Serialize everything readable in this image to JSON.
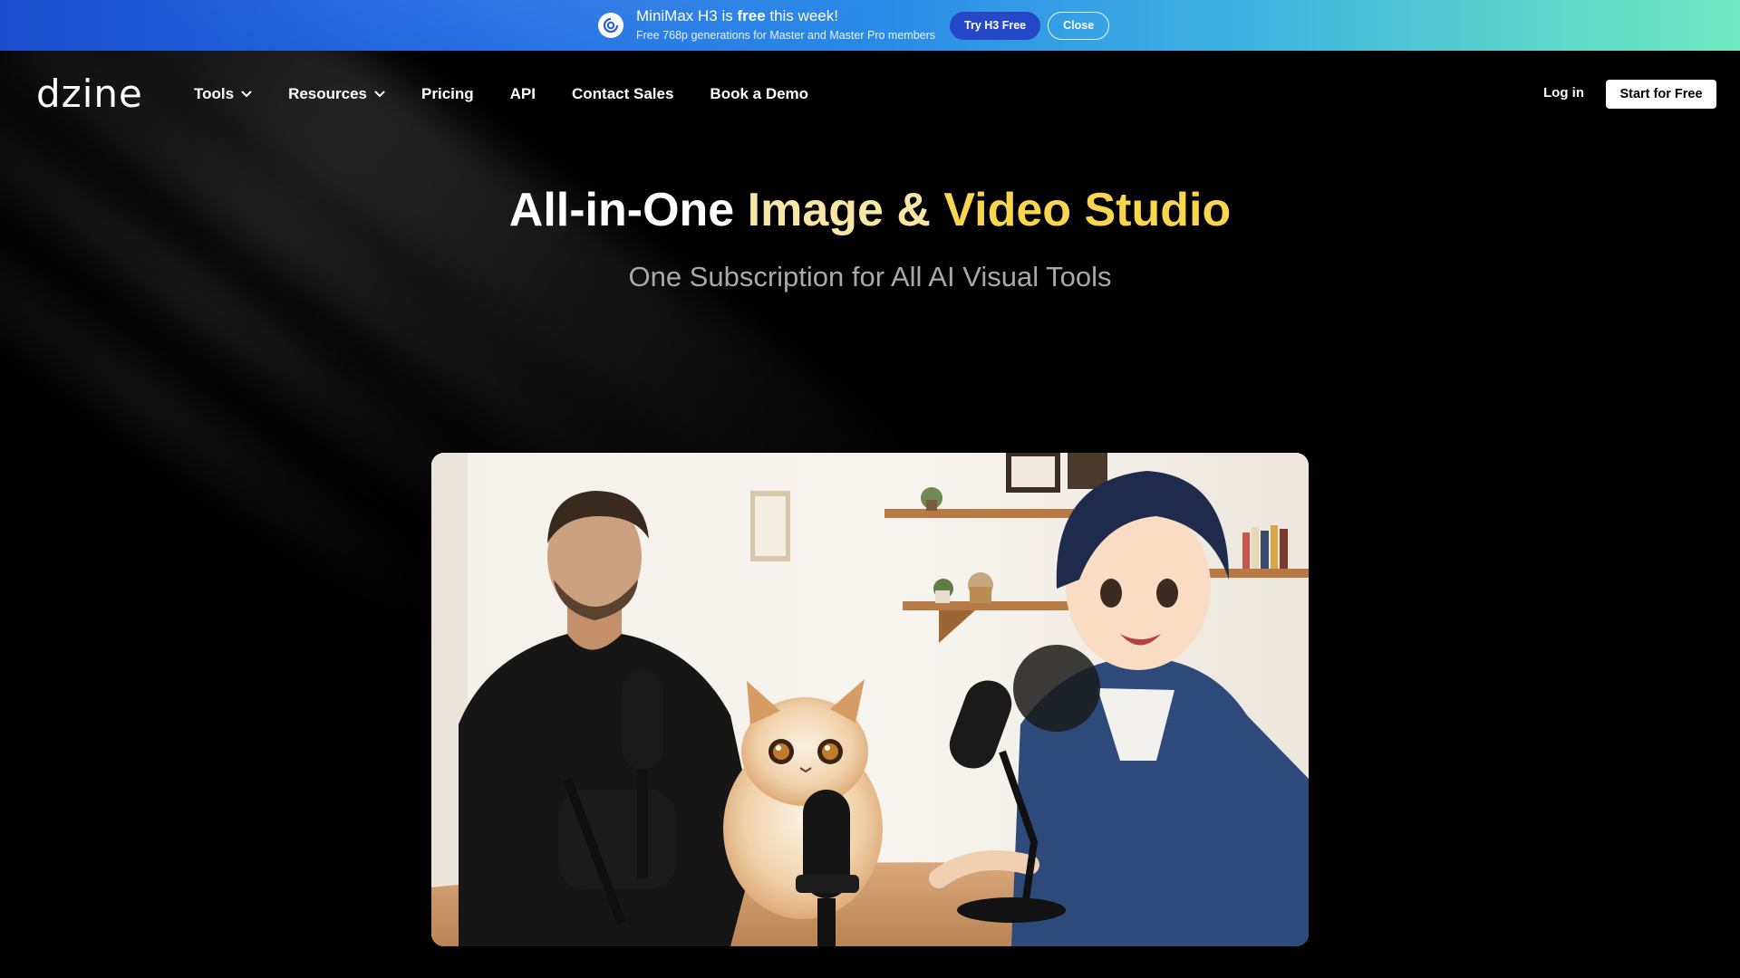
{
  "banner": {
    "headline_prefix": "MiniMax H3 is ",
    "headline_bold": "free",
    "headline_suffix": " this week!",
    "subtext": "Free 768p generations for Master and Master Pro members",
    "try_button": "Try H3 Free",
    "close_button": "Close",
    "icon": "minimax-logo-icon"
  },
  "nav": {
    "logo": "dzine",
    "items": [
      {
        "label": "Tools",
        "has_dropdown": true
      },
      {
        "label": "Resources",
        "has_dropdown": true
      },
      {
        "label": "Pricing",
        "has_dropdown": false
      },
      {
        "label": "API",
        "has_dropdown": false
      },
      {
        "label": "Contact Sales",
        "has_dropdown": false
      },
      {
        "label": "Book a Demo",
        "has_dropdown": false
      }
    ],
    "login": "Log in",
    "cta": "Start for Free"
  },
  "hero": {
    "title_part1": "All-in-One ",
    "title_part2": "Image & ",
    "title_part3": "Video Studio",
    "subtitle": "One Subscription for All AI Visual Tools"
  },
  "colors": {
    "accent_gold": "#f9d64f",
    "accent_light_gold": "#f7e6a6",
    "banner_button": "#2747c9"
  }
}
